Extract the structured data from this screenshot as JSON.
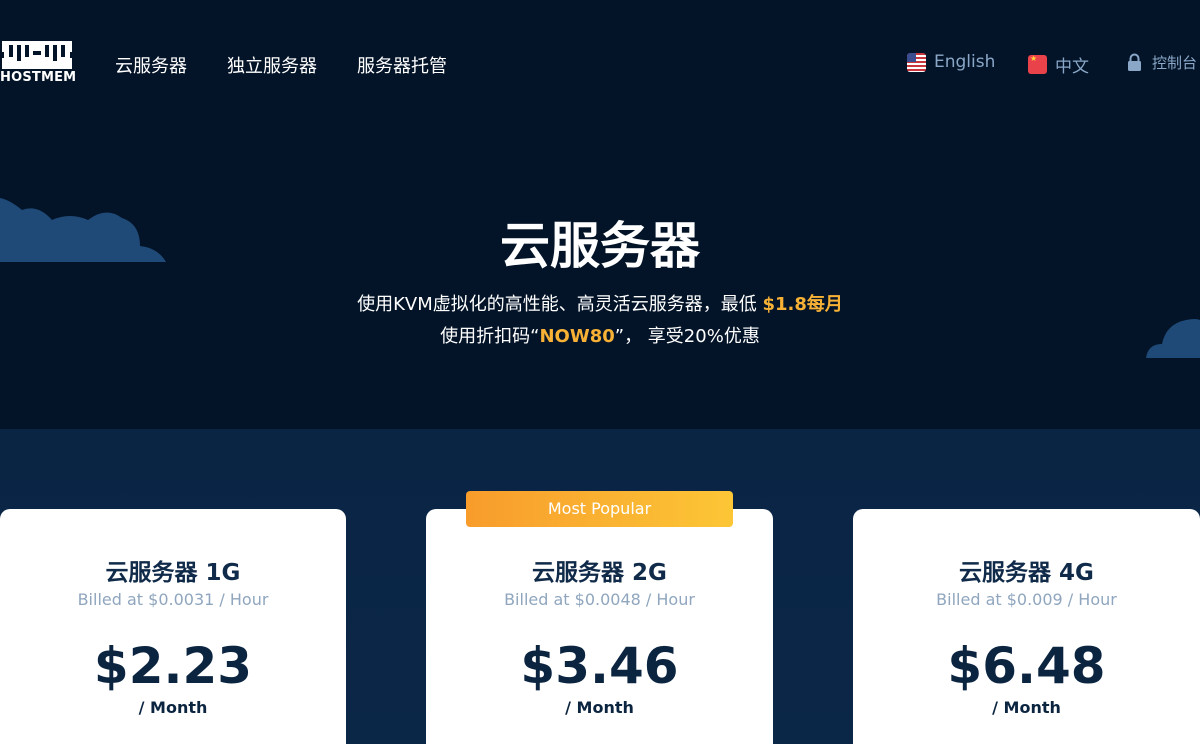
{
  "brand": {
    "name": "HOSTMEM"
  },
  "nav": {
    "links": [
      "云服务器",
      "独立服务器",
      "服务器托管"
    ],
    "languages": [
      {
        "label": "English",
        "icon": "us-flag-icon"
      },
      {
        "label": "中文",
        "icon": "cn-flag-icon"
      }
    ],
    "console_label": "控制台"
  },
  "hero": {
    "title": "云服务器",
    "line1_text": "使用KVM虚拟化的高性能、高灵活云服务器，最低 ",
    "line1_highlight": "$1.8每月",
    "line2_prefix": "使用折扣码“",
    "line2_code": "NOW80",
    "line2_suffix": "”， 享受20%优惠"
  },
  "plans": [
    {
      "title": "云服务器 1G",
      "billed": "Billed at $0.0031 / Hour",
      "price": "$2.23",
      "period": "/ Month"
    },
    {
      "title": "云服务器 2G",
      "billed": "Billed at $0.0048 / Hour",
      "price": "$3.46",
      "period": "/ Month",
      "badge": "Most Popular"
    },
    {
      "title": "云服务器 4G",
      "billed": "Billed at $0.009 / Hour",
      "price": "$6.48",
      "period": "/ Month"
    }
  ],
  "colors": {
    "background": "#031428",
    "lower_background": "#0a2444",
    "accent": "#f7b236",
    "link": "#8aa7c7",
    "card_text": "#0b2440"
  }
}
